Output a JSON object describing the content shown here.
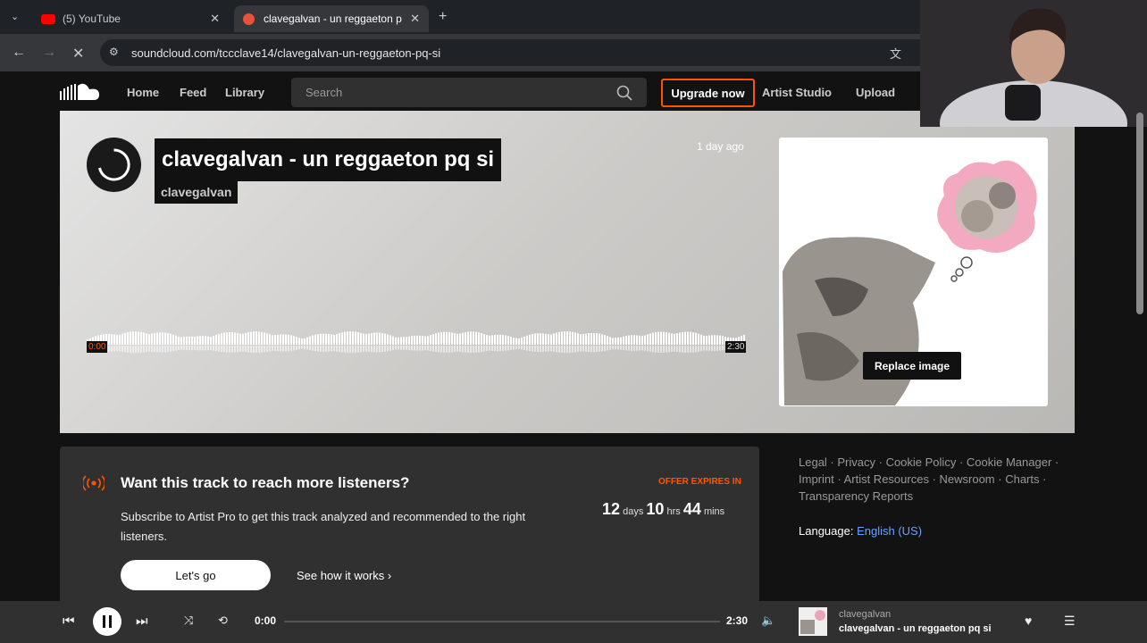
{
  "browser": {
    "tabs": [
      {
        "label": "(5) YouTube"
      },
      {
        "label": "clavegalvan - un reggaeton pq"
      }
    ],
    "url": "soundcloud.com/tccclave14/clavegalvan-un-reggaeton-pq-si"
  },
  "header": {
    "nav": [
      "Home",
      "Feed",
      "Library"
    ],
    "search_placeholder": "Search",
    "upgrade_label": "Upgrade now",
    "artist_studio": "Artist Studio",
    "upload": "Upload"
  },
  "track": {
    "title": "clavegalvan - un reggaeton pq si",
    "artist": "clavegalvan",
    "posted": "1 day ago",
    "time_start": "0:00",
    "time_end": "2:30",
    "replace_image": "Replace image"
  },
  "promo": {
    "title": "Want this track to reach more listeners?",
    "body": "Subscribe to Artist Pro to get this track analyzed and recommended to the right listeners.",
    "offer": "OFFER EXPIRES IN",
    "days": "12",
    "days_unit": "days",
    "hrs": "10",
    "hrs_unit": "hrs",
    "mins": "44",
    "mins_unit": "mins",
    "cta": "Let's go",
    "secondary": "See how it works"
  },
  "footer": {
    "links": [
      "Legal",
      "Privacy",
      "Cookie Policy",
      "Cookie Manager",
      "Imprint",
      "Artist Resources",
      "Newsroom",
      "Charts",
      "Transparency Reports"
    ],
    "language_label": "Language:",
    "language_value": "English (US)"
  },
  "player": {
    "current": "0:00",
    "duration": "2:30",
    "artist": "clavegalvan",
    "title": "clavegalvan - un reggaeton pq si",
    "progress": 0
  },
  "colors": {
    "accent": "#ff5500",
    "link": "#6aa1ff"
  }
}
